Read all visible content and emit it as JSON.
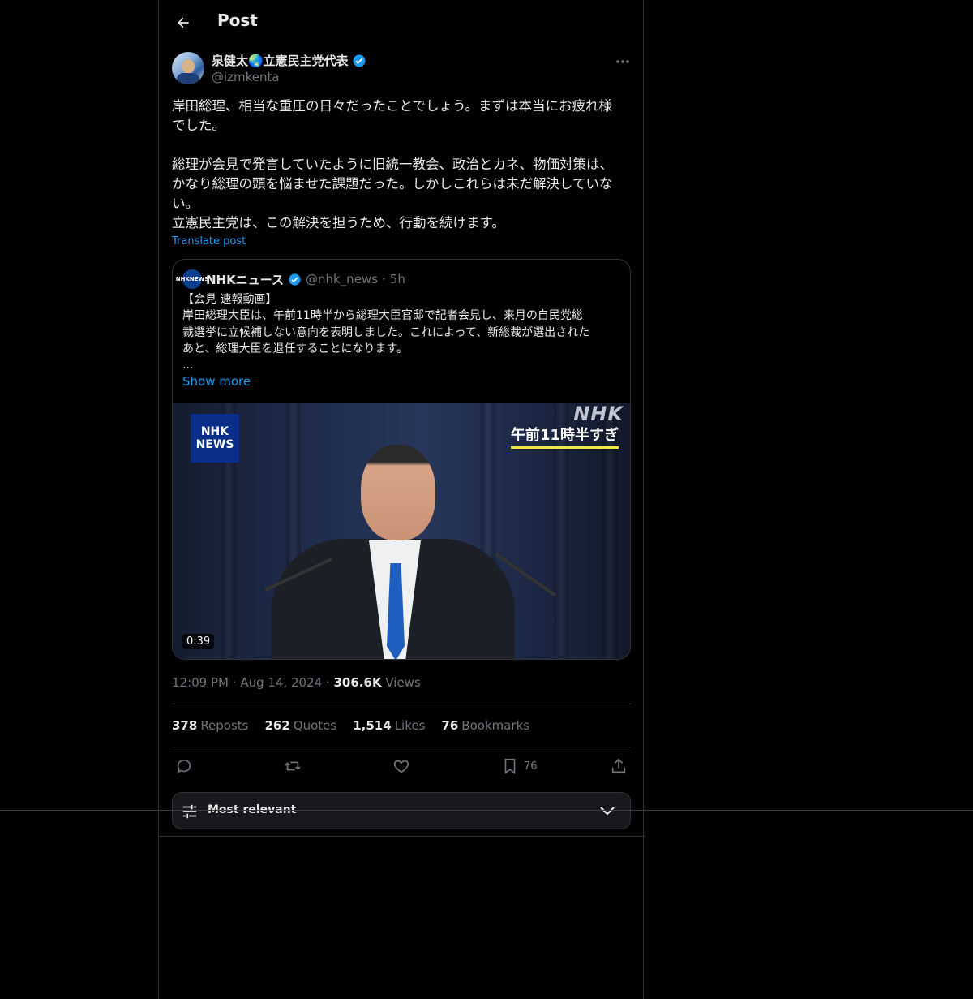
{
  "header": {
    "title": "Post"
  },
  "post": {
    "author_name": "泉健太🌏立憲民主党代表",
    "author_handle": "@izmkenta",
    "text": "岸田総理、相当な重圧の日々だったことでしょう。まずは本当にお疲れ様\nでした。\n\n総理が会見で発言していたように旧統一教会、政治とカネ、物価対策は、\nかなり総理の頭を悩ませた課題だった。しかしこれらは未だ解決していな\nい。\n立憲民主党は、この解決を担うため、行動を続けます。",
    "translate_label": "Translate post",
    "time": "12:09 PM",
    "date": "Aug 14, 2024",
    "views_count": "306.6K",
    "views_label": "Views"
  },
  "quote": {
    "name": "NHKニュース",
    "handle": "@nhk_news",
    "age": "5h",
    "text": "【会見 速報動画】\n岸田総理大臣は、午前11時半から総理大臣官邸で記者会見し、来月の自民党総\n裁選挙に立候補しない意向を表明しました。これによって、新総裁が選出された\nあと、総理大臣を退任することになります。\n...",
    "show_more": "Show more",
    "logo_text_1": "NHK",
    "logo_text_2": "NEWS",
    "video": {
      "nhk_box_1": "NHK",
      "nhk_box_2": "NEWS",
      "nhk_mark": "NHK",
      "caption": "午前11時半すぎ",
      "duration": "0:39"
    }
  },
  "stats": {
    "reposts_count": "378",
    "reposts_label": "Reposts",
    "quotes_count": "262",
    "quotes_label": "Quotes",
    "likes_count": "1,514",
    "likes_label": "Likes",
    "bookmarks_count": "76",
    "bookmarks_label": "Bookmarks"
  },
  "actions": {
    "bookmark_count": "76"
  },
  "sort": {
    "label": "Most relevant"
  },
  "colors": {
    "accent": "#1d9bf0",
    "background": "#000000",
    "muted": "#71767b",
    "border": "#2f3336"
  },
  "icons": [
    "back-arrow-icon",
    "verified-badge-icon",
    "more-icon",
    "reply-icon",
    "repost-icon",
    "like-icon",
    "bookmark-icon",
    "share-icon",
    "sliders-icon",
    "chevron-down-icon"
  ]
}
